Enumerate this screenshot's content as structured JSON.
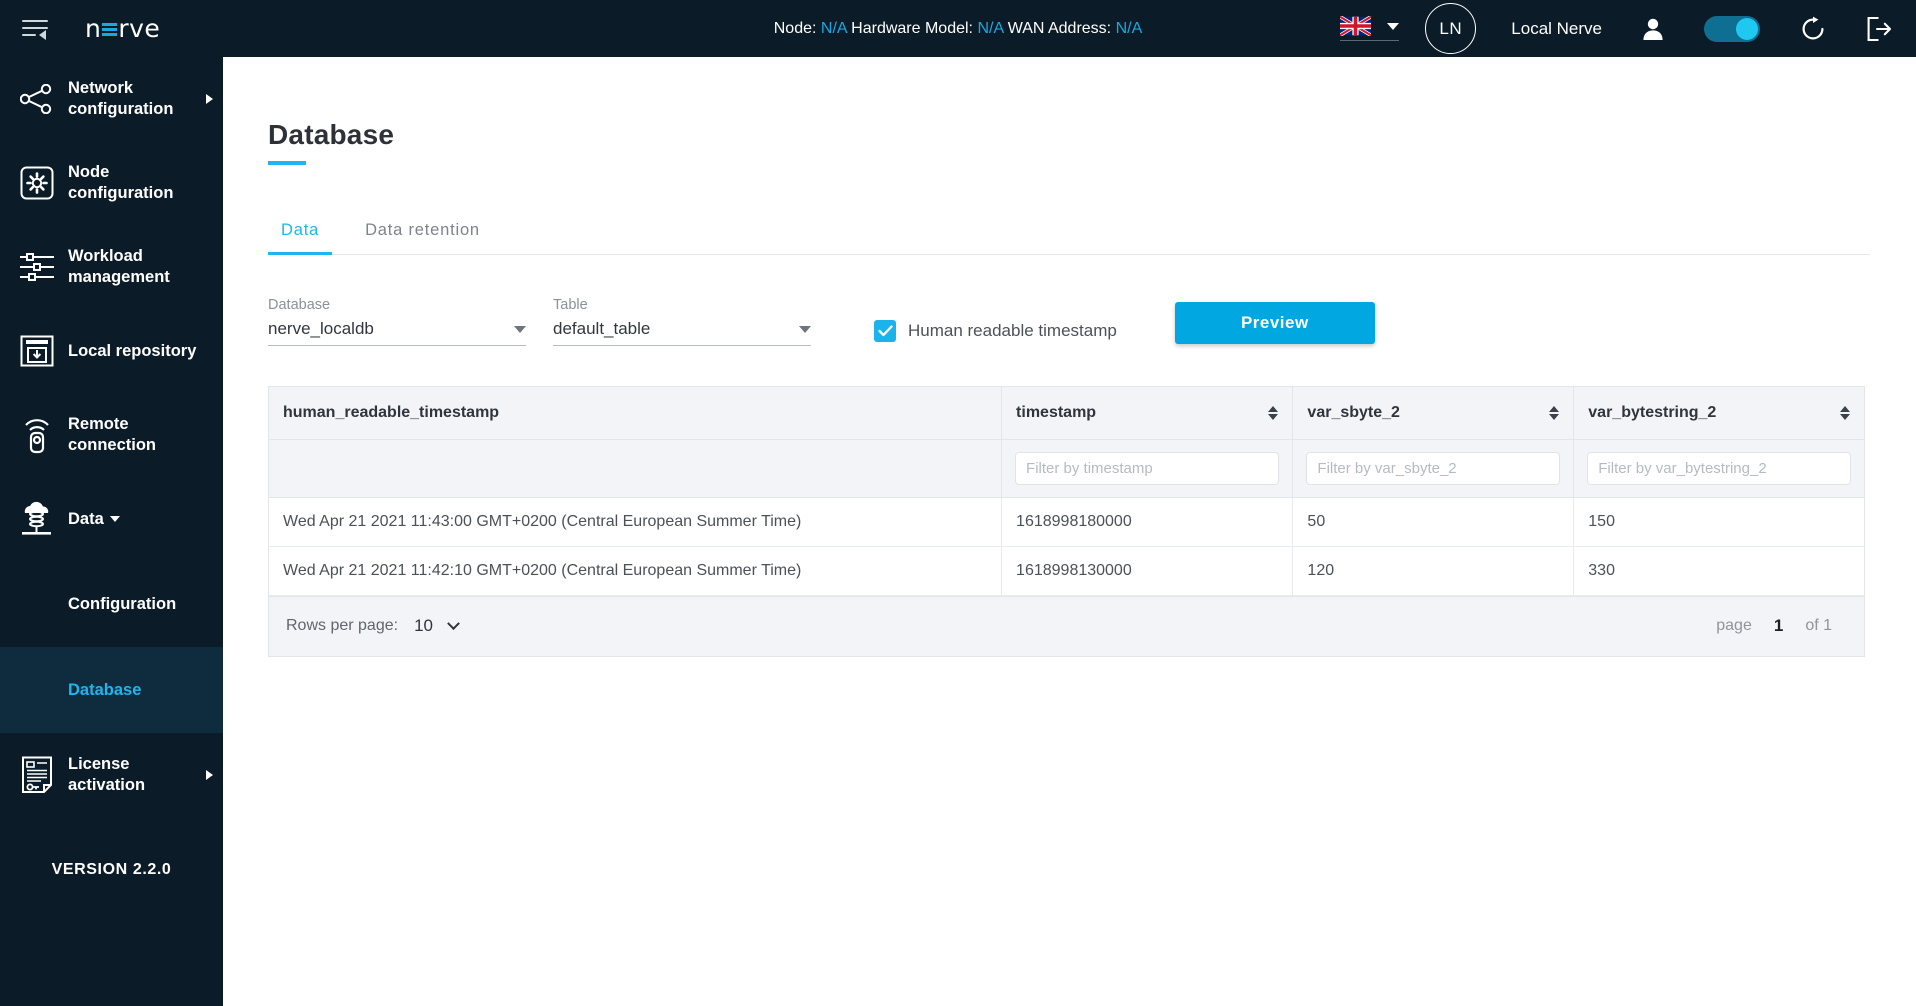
{
  "topbar": {
    "menu_icon": "collapse-menu-icon",
    "logo_text_1": "n",
    "logo_text_2": "rve",
    "node_label": "Node:",
    "node_value": "N/A",
    "hardware_label": "Hardware Model:",
    "hardware_value": "N/A",
    "wan_label": "WAN Address:",
    "wan_value": "N/A",
    "language_flag": "uk-flag-icon",
    "avatar_initials": "LN",
    "username": "Local Nerve",
    "person_icon": "person-icon",
    "toggle_state": "on",
    "refresh_icon": "refresh-icon",
    "logout_icon": "logout-icon",
    "accent": "#17a9e0",
    "background": "#0b1c28"
  },
  "sidebar": {
    "items": [
      {
        "label": "Network configuration",
        "icon": "network-share-icon",
        "has_arrow": true
      },
      {
        "label": "Node configuration",
        "icon": "gear-square-icon",
        "has_arrow": false
      },
      {
        "label": "Workload management",
        "icon": "sliders-icon",
        "has_arrow": false
      },
      {
        "label": "Local repository",
        "icon": "repository-download-icon",
        "has_arrow": false
      },
      {
        "label": "Remote connection",
        "icon": "remote-control-icon",
        "has_arrow": false
      },
      {
        "label": "Data",
        "icon": "cloud-database-icon",
        "has_arrow": false,
        "has_caret": true
      }
    ],
    "sub_items": [
      {
        "label": "Configuration",
        "active": false
      },
      {
        "label": "Database",
        "active": true
      }
    ],
    "license": {
      "label": "License activation",
      "icon": "license-document-icon",
      "has_arrow": true
    },
    "version": "VERSION 2.2.0",
    "active_color": "#1fb6ef"
  },
  "main": {
    "title": "Database",
    "tabs": [
      {
        "label": "Data",
        "active": true
      },
      {
        "label": "Data retention",
        "active": false
      }
    ],
    "controls": {
      "database_label": "Database",
      "database_value": "nerve_localdb",
      "table_label": "Table",
      "table_value": "default_table",
      "checkbox_label": "Human readable timestamp",
      "checkbox_checked": true,
      "preview_button": "Preview"
    },
    "table": {
      "columns": [
        {
          "key": "human_readable_timestamp",
          "label": "human_readable_timestamp",
          "sortable": false,
          "filter_placeholder": ""
        },
        {
          "key": "timestamp",
          "label": "timestamp",
          "sortable": true,
          "filter_placeholder": "Filter by timestamp"
        },
        {
          "key": "var_sbyte_2",
          "label": "var_sbyte_2",
          "sortable": true,
          "filter_placeholder": "Filter by var_sbyte_2"
        },
        {
          "key": "var_bytestring_2",
          "label": "var_bytestring_2",
          "sortable": true,
          "filter_placeholder": "Filter by var_bytestring_2"
        }
      ],
      "rows": [
        {
          "human_readable_timestamp": "Wed Apr 21 2021 11:43:00 GMT+0200 (Central European Summer Time)",
          "timestamp": "1618998180000",
          "var_sbyte_2": "50",
          "var_bytestring_2": "150"
        },
        {
          "human_readable_timestamp": "Wed Apr 21 2021 11:42:10 GMT+0200 (Central European Summer Time)",
          "timestamp": "1618998130000",
          "var_sbyte_2": "120",
          "var_bytestring_2": "330"
        }
      ],
      "footer": {
        "rows_per_page_label": "Rows per page:",
        "rows_per_page_value": "10",
        "page_word": "page",
        "page_number": "1",
        "page_of": "of 1"
      }
    }
  }
}
